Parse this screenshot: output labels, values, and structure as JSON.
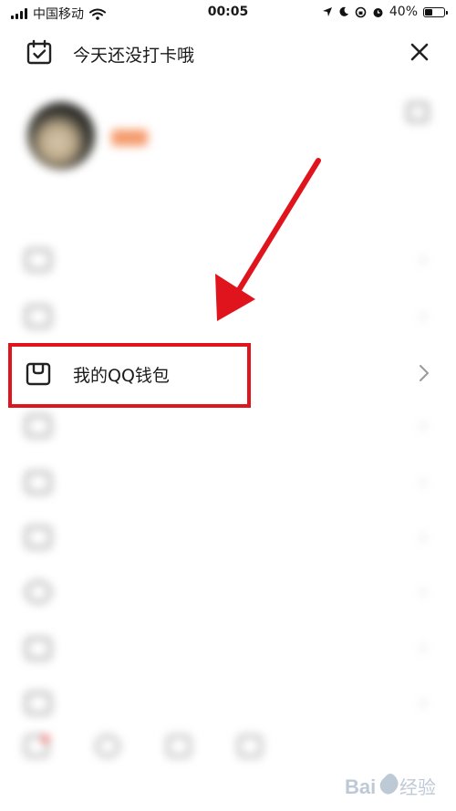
{
  "status_bar": {
    "carrier": "中国移动",
    "time": "00:05",
    "battery": "40%",
    "battery_level": 0.4
  },
  "checkin": {
    "text": "今天还没打卡哦"
  },
  "profile": {
    "name": "",
    "level_text": "",
    "signature": ""
  },
  "menu": {
    "wallet_label": "我的QQ钱包"
  },
  "accent": {
    "highlight": "#e0141d"
  },
  "watermark": {
    "text": "Bai经验"
  }
}
